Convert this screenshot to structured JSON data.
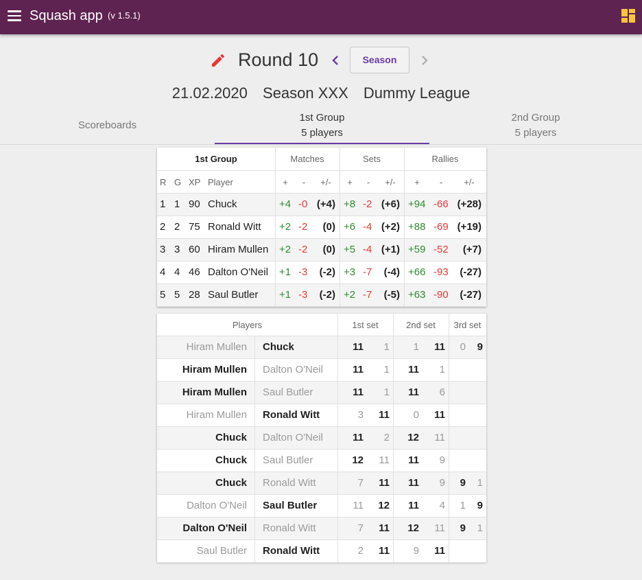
{
  "header": {
    "title": "Squash app",
    "version": "(v 1.5.1)",
    "brand_color": "#5e2350",
    "accent_color": "#f9c53c",
    "menu_icon": "hamburger-menu-icon",
    "dashboard_icon": "dashboard-icon"
  },
  "round": {
    "title": "Round 10",
    "season_button": "Season",
    "edit_icon": "pencil-icon",
    "prev_icon": "chevron-left-icon",
    "next_icon": "chevron-right-icon"
  },
  "subtitle": {
    "date": "21.02.2020",
    "season": "Season XXX",
    "league": "Dummy League"
  },
  "tabs": [
    {
      "line1": "Scoreboards",
      "line2": ""
    },
    {
      "line1": "1st Group",
      "line2": "5 players",
      "active": true
    },
    {
      "line1": "2nd Group",
      "line2": "5 players"
    }
  ],
  "standings": {
    "group_label": "1st Group",
    "headers": {
      "matches": "Matches",
      "sets": "Sets",
      "rallies": "Rallies"
    },
    "subheaders": {
      "r": "R",
      "g": "G",
      "xp": "XP",
      "player": "Player",
      "plus": "+",
      "minus": "-",
      "diff": "+/-"
    },
    "rows": [
      {
        "r": "1",
        "g": "1",
        "xp": "90",
        "player": "Chuck",
        "mp": "+4",
        "mm": "-0",
        "md": "(+4)",
        "sp": "+8",
        "sm": "-2",
        "sd": "(+6)",
        "rp": "+94",
        "rm": "-66",
        "rd": "(+28)"
      },
      {
        "r": "2",
        "g": "2",
        "xp": "75",
        "player": "Ronald Witt",
        "mp": "+2",
        "mm": "-2",
        "md": "(0)",
        "sp": "+6",
        "sm": "-4",
        "sd": "(+2)",
        "rp": "+88",
        "rm": "-69",
        "rd": "(+19)"
      },
      {
        "r": "3",
        "g": "3",
        "xp": "60",
        "player": "Hiram Mullen",
        "mp": "+2",
        "mm": "-2",
        "md": "(0)",
        "sp": "+5",
        "sm": "-4",
        "sd": "(+1)",
        "rp": "+59",
        "rm": "-52",
        "rd": "(+7)"
      },
      {
        "r": "4",
        "g": "4",
        "xp": "46",
        "player": "Dalton O'Neil",
        "mp": "+1",
        "mm": "-3",
        "md": "(-2)",
        "sp": "+3",
        "sm": "-7",
        "sd": "(-4)",
        "rp": "+66",
        "rm": "-93",
        "rd": "(-27)"
      },
      {
        "r": "5",
        "g": "5",
        "xp": "28",
        "player": "Saul Butler",
        "mp": "+1",
        "mm": "-3",
        "md": "(-2)",
        "sp": "+2",
        "sm": "-7",
        "sd": "(-5)",
        "rp": "+63",
        "rm": "-90",
        "rd": "(-27)"
      }
    ]
  },
  "matches": {
    "headers": {
      "players": "Players",
      "set1": "1st set",
      "set2": "2nd set",
      "set3": "3rd set"
    },
    "rows": [
      {
        "p1": "Hiram Mullen",
        "p2": "Chuck",
        "w": 2,
        "s1": [
          "11",
          "1"
        ],
        "s2": [
          "1",
          "11"
        ],
        "s3": [
          "0",
          "9"
        ]
      },
      {
        "p1": "Hiram Mullen",
        "p2": "Dalton O'Neil",
        "w": 1,
        "s1": [
          "11",
          "1"
        ],
        "s2": [
          "11",
          "1"
        ],
        "s3": [
          "",
          ""
        ]
      },
      {
        "p1": "Hiram Mullen",
        "p2": "Saul Butler",
        "w": 1,
        "s1": [
          "11",
          "1"
        ],
        "s2": [
          "11",
          "6"
        ],
        "s3": [
          "",
          ""
        ]
      },
      {
        "p1": "Hiram Mullen",
        "p2": "Ronald Witt",
        "w": 2,
        "s1": [
          "3",
          "11"
        ],
        "s2": [
          "0",
          "11"
        ],
        "s3": [
          "",
          ""
        ]
      },
      {
        "p1": "Chuck",
        "p2": "Dalton O'Neil",
        "w": 1,
        "s1": [
          "11",
          "2"
        ],
        "s2": [
          "12",
          "11"
        ],
        "s3": [
          "",
          ""
        ]
      },
      {
        "p1": "Chuck",
        "p2": "Saul Butler",
        "w": 1,
        "s1": [
          "12",
          "11"
        ],
        "s2": [
          "11",
          "9"
        ],
        "s3": [
          "",
          ""
        ]
      },
      {
        "p1": "Chuck",
        "p2": "Ronald Witt",
        "w": 1,
        "s1": [
          "7",
          "11"
        ],
        "s2": [
          "11",
          "9"
        ],
        "s3": [
          "9",
          "1"
        ]
      },
      {
        "p1": "Dalton O'Neil",
        "p2": "Saul Butler",
        "w": 2,
        "s1": [
          "11",
          "12"
        ],
        "s2": [
          "11",
          "4"
        ],
        "s3": [
          "1",
          "9"
        ]
      },
      {
        "p1": "Dalton O'Neil",
        "p2": "Ronald Witt",
        "w": 1,
        "s1": [
          "7",
          "11"
        ],
        "s2": [
          "12",
          "11"
        ],
        "s3": [
          "9",
          "1"
        ]
      },
      {
        "p1": "Saul Butler",
        "p2": "Ronald Witt",
        "w": 2,
        "s1": [
          "2",
          "11"
        ],
        "s2": [
          "9",
          "11"
        ],
        "s3": [
          "",
          ""
        ]
      }
    ]
  }
}
